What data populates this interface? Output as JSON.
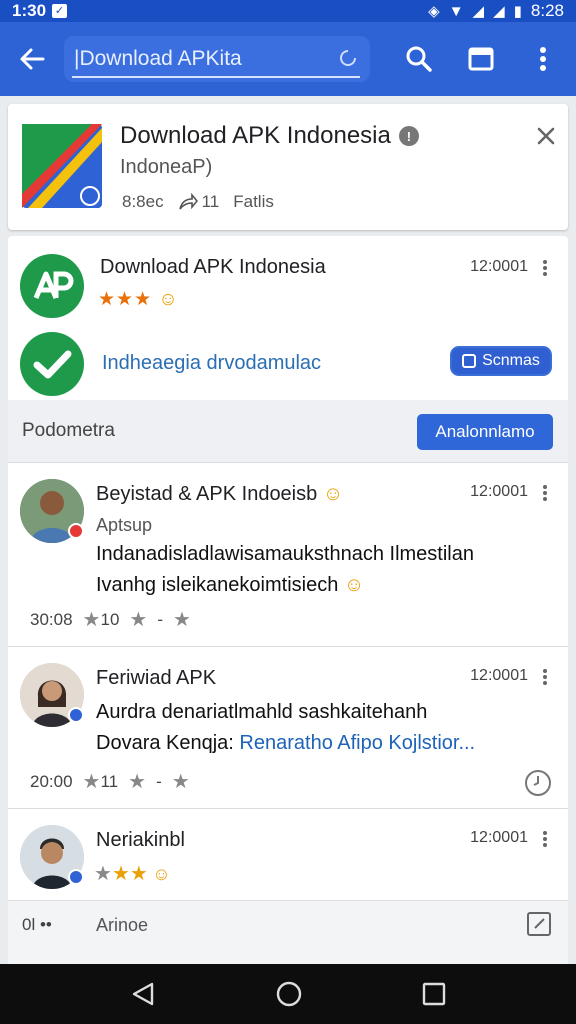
{
  "status": {
    "time": "1:30",
    "right_time": "8:28"
  },
  "search": {
    "value": "|Download APKita"
  },
  "hero": {
    "title": "Download APK Indonesia",
    "subtitle": "IndoneaP)",
    "meta_1": "8:8ec",
    "meta_2": "11",
    "meta_3": "Fatlis"
  },
  "app_row": {
    "name": "Download APK Indonesia",
    "time": "12:0001",
    "stars": "★★★"
  },
  "verify": {
    "text": "Indheaegia drvodamulac",
    "button": "Scnmas"
  },
  "section": {
    "label": "Podometra",
    "button": "Analonnlamo"
  },
  "reviews": [
    {
      "name": "Beyistad & APK Indoeisb",
      "sub": "Aptsup",
      "time": "12:0001",
      "body_1": "Indanadisladlawisamauksthnach Ilmestilan",
      "body_2": "Ivanhg isleikanekoimtisiech",
      "foot_time": "30:08",
      "foot_count": "10"
    },
    {
      "name": "Feriwiad APK",
      "time": "12:0001",
      "body_1": "Aurdra denariatlmahld sashkaitehanh",
      "body_2a": "Dovara Kenqja: ",
      "body_2b": "Renaratho Afipo Kojlstior...",
      "foot_time": "20:00",
      "foot_count": "11"
    },
    {
      "name": "Neriakinbl",
      "time": "12:0001",
      "stars": "★★",
      "foot_time": "0l",
      "foot_label": "Arinoe"
    }
  ],
  "colors": {
    "appbar": "#2e63d6",
    "statusbar": "#1a4fc4",
    "accent_button": "#2f66d8",
    "green": "#1e9a4a"
  }
}
